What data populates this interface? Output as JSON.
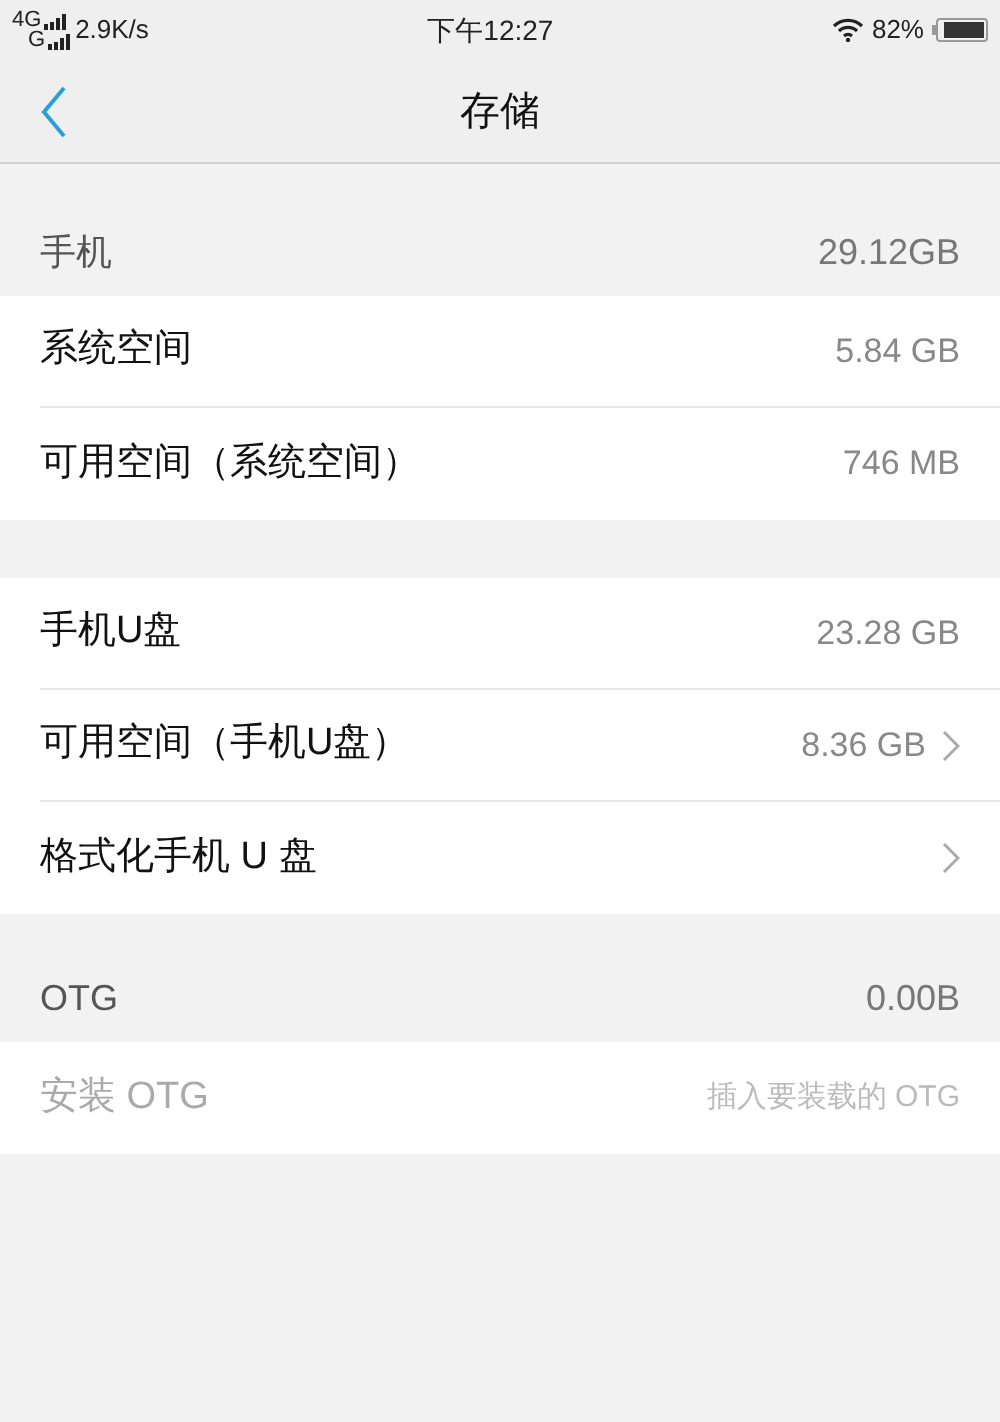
{
  "status_bar": {
    "network_top": "4G",
    "network_bottom": "G",
    "speed": "2.9K/s",
    "time": "下午12:27",
    "battery": "82%"
  },
  "nav": {
    "title": "存储"
  },
  "sections": [
    {
      "header": {
        "label": "手机",
        "value": "29.12GB"
      },
      "rows": [
        {
          "label": "系统空间",
          "value": "5.84 GB",
          "chevron": false,
          "disabled": false
        },
        {
          "label": "可用空间（系统空间）",
          "value": "746 MB",
          "chevron": false,
          "disabled": false
        }
      ]
    },
    {
      "rows": [
        {
          "label": "手机U盘",
          "value": "23.28 GB",
          "chevron": false,
          "disabled": false
        },
        {
          "label": "可用空间（手机U盘）",
          "value": "8.36 GB",
          "chevron": true,
          "disabled": false
        },
        {
          "label": "格式化手机 U 盘",
          "chevron": true,
          "disabled": false
        }
      ]
    },
    {
      "header": {
        "label": "OTG",
        "value": "0.00B"
      },
      "rows": [
        {
          "label": "安装 OTG",
          "value": "插入要装载的 OTG",
          "chevron": false,
          "disabled": true
        }
      ]
    }
  ]
}
